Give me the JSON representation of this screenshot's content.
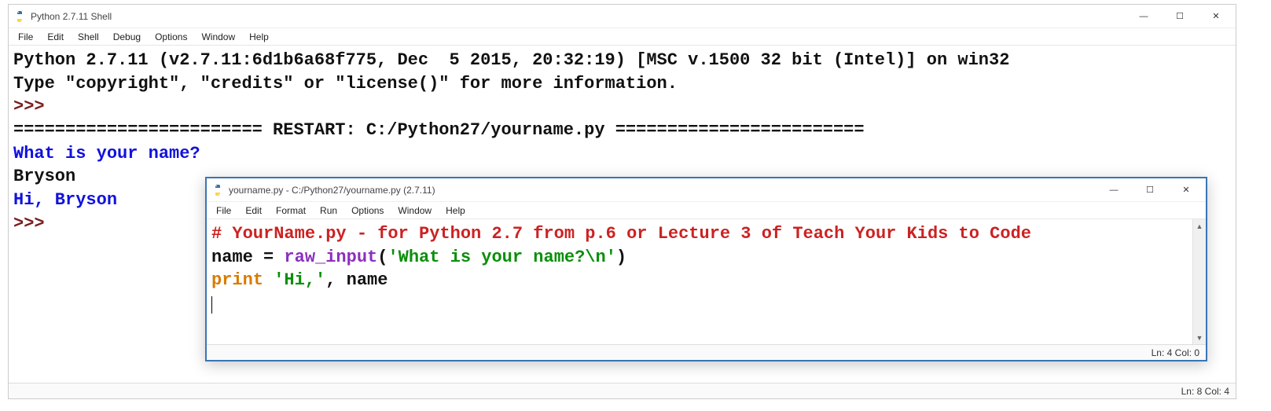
{
  "shell": {
    "title": "Python 2.7.11 Shell",
    "menus": [
      "File",
      "Edit",
      "Shell",
      "Debug",
      "Options",
      "Window",
      "Help"
    ],
    "lines": {
      "banner1": "Python 2.7.11 (v2.7.11:6d1b6a68f775, Dec  5 2015, 20:32:19) [MSC v.1500 32 bit (Intel)] on win32",
      "banner2": "Type \"copyright\", \"credits\" or \"license()\" for more information.",
      "prompt1": ">>> ",
      "restart": "======================== RESTART: C:/Python27/yourname.py ========================",
      "question": "What is your name?",
      "input_echo": "Bryson",
      "greeting": "Hi, Bryson",
      "prompt2": ">>> "
    },
    "status": "Ln: 8  Col: 4"
  },
  "editor": {
    "title": "yourname.py - C:/Python27/yourname.py (2.7.11)",
    "menus": [
      "File",
      "Edit",
      "Format",
      "Run",
      "Options",
      "Window",
      "Help"
    ],
    "code": {
      "comment": "# YourName.py - for Python 2.7 from p.6 or Lecture 3 of Teach Your Kids to Code",
      "assign_lhs": "name = ",
      "raw_input": "raw_input",
      "paren_open": "(",
      "str_arg": "'What is your name?\\n'",
      "paren_close": ")",
      "print_kw": "print",
      "sp": " ",
      "str_hi": "'Hi,'",
      "comma_name": ", name"
    },
    "status": "Ln: 4  Col: 0"
  },
  "winbtns": {
    "min": "—",
    "max": "☐",
    "close": "✕"
  }
}
